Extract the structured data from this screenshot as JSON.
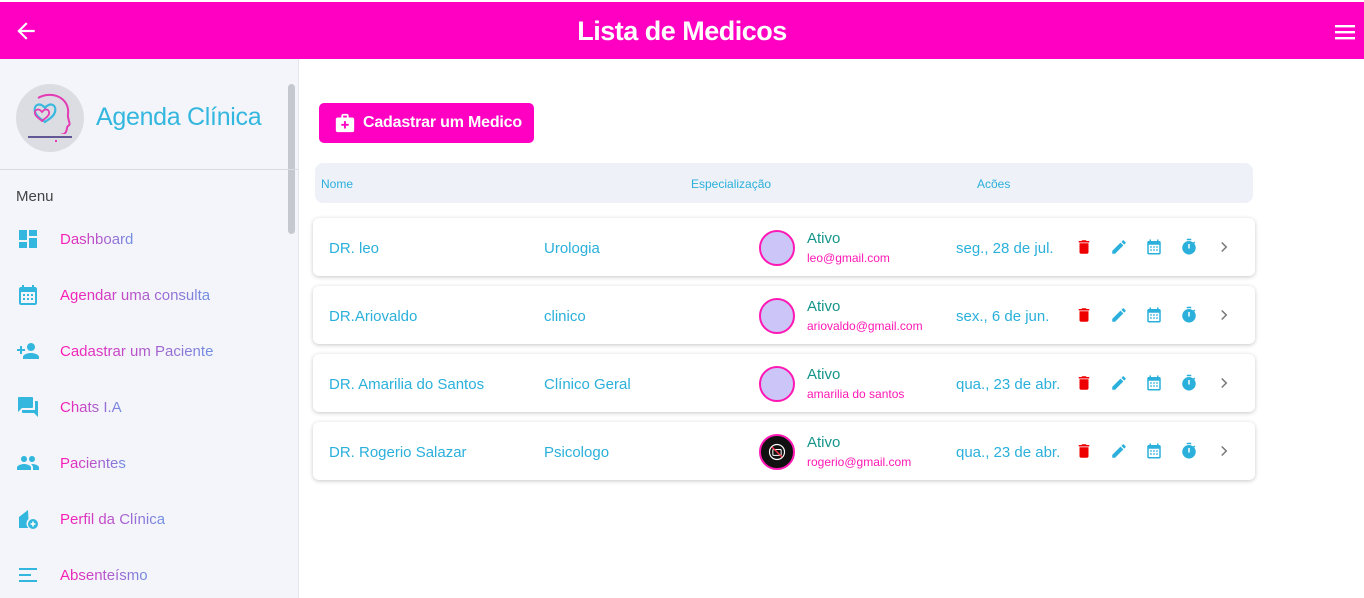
{
  "header": {
    "title": "Lista de Medicos",
    "colors": {
      "primary": "#ff00c3",
      "accent": "#2ab0db"
    }
  },
  "sidebar": {
    "brand_name": "Agenda Clínica",
    "menu_label": "Menu",
    "items": [
      {
        "label": "Dashboard",
        "icon": "dashboard-icon"
      },
      {
        "label": "Agendar uma consulta",
        "icon": "calendar-icon"
      },
      {
        "label": "Cadastrar um Paciente",
        "icon": "person-add-icon"
      },
      {
        "label": "Chats I.A",
        "icon": "chat-icon"
      },
      {
        "label": "Pacientes",
        "icon": "people-icon"
      },
      {
        "label": "Perfil da Clínica",
        "icon": "clinic-profile-icon"
      },
      {
        "label": "Absenteísmo",
        "icon": "list-icon"
      }
    ]
  },
  "main": {
    "add_button": "Cadastrar um Medico",
    "columns": [
      "Nome",
      "Especialização",
      "Acões"
    ],
    "doctors": [
      {
        "name": "DR. leo",
        "specialty": "Urologia",
        "status": "Ativo",
        "email": "leo@gmail.com",
        "date": "seg., 28 de jul."
      },
      {
        "name": "DR.Ariovaldo",
        "specialty": "clinico",
        "status": "Ativo",
        "email": "ariovaldo@gmail.com",
        "date": "sex., 6 de jun."
      },
      {
        "name": "DR. Amarilia do Santos",
        "specialty": "Clínico Geral",
        "status": "Ativo",
        "email": "amarilia do santos",
        "date": "qua., 23 de abr."
      },
      {
        "name": "DR. Rogerio Salazar",
        "specialty": "Psicologo",
        "status": "Ativo",
        "email": "rogerio@gmail.com",
        "date": "qua., 23 de abr."
      }
    ],
    "action_icons": [
      "delete-icon",
      "edit-icon",
      "calendar-icon",
      "timer-icon",
      "chevron-right-icon"
    ]
  }
}
